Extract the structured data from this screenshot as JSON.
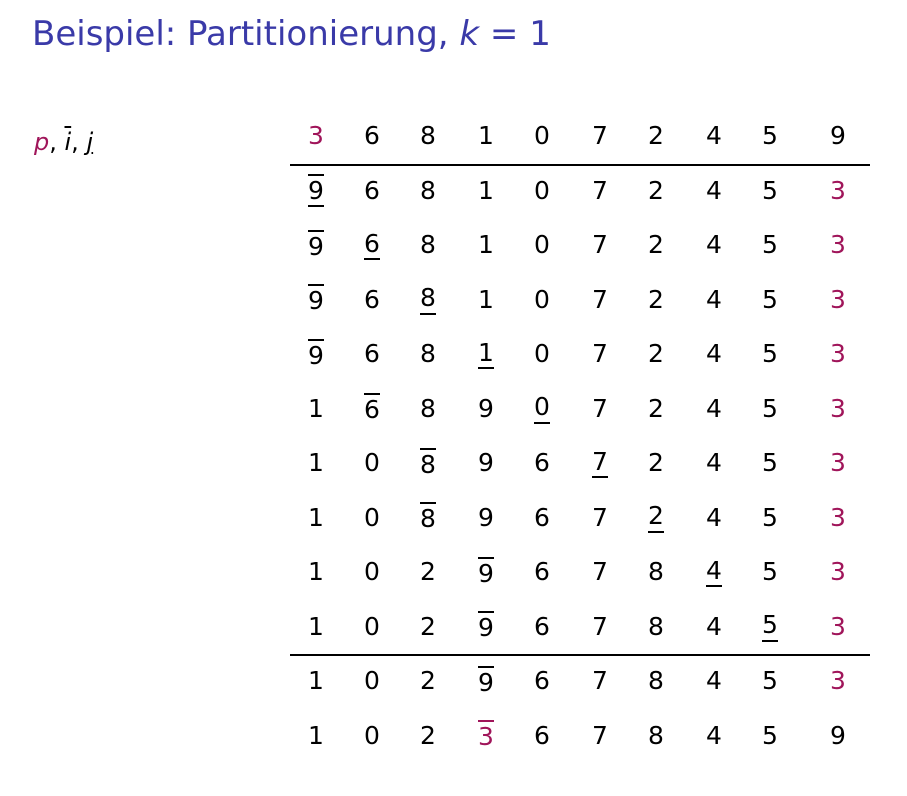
{
  "title": {
    "prefix": "Beispiel: Partitionierung, ",
    "var": "k",
    "suffix": " = 1"
  },
  "legend": {
    "pivot": "p",
    "sep1": ", ",
    "i": "i",
    "sep2": ", ",
    "j": "j"
  },
  "colors": {
    "title": "#3a3aa8",
    "pivot": "#a0155a",
    "text": "#000000"
  },
  "rows": [
    {
      "cells": [
        {
          "v": "3",
          "pivot": true
        },
        {
          "v": "6"
        },
        {
          "v": "8"
        },
        {
          "v": "1"
        },
        {
          "v": "0"
        },
        {
          "v": "7"
        },
        {
          "v": "2"
        },
        {
          "v": "4"
        },
        {
          "v": "5"
        },
        {
          "v": "9"
        }
      ]
    },
    {
      "cells": [
        {
          "v": "9",
          "over": true,
          "under": true
        },
        {
          "v": "6"
        },
        {
          "v": "8"
        },
        {
          "v": "1"
        },
        {
          "v": "0"
        },
        {
          "v": "7"
        },
        {
          "v": "2"
        },
        {
          "v": "4"
        },
        {
          "v": "5"
        },
        {
          "v": "3",
          "pivot": true
        }
      ]
    },
    {
      "cells": [
        {
          "v": "9",
          "over": true
        },
        {
          "v": "6",
          "under": true
        },
        {
          "v": "8"
        },
        {
          "v": "1"
        },
        {
          "v": "0"
        },
        {
          "v": "7"
        },
        {
          "v": "2"
        },
        {
          "v": "4"
        },
        {
          "v": "5"
        },
        {
          "v": "3",
          "pivot": true
        }
      ]
    },
    {
      "cells": [
        {
          "v": "9",
          "over": true
        },
        {
          "v": "6"
        },
        {
          "v": "8",
          "under": true
        },
        {
          "v": "1"
        },
        {
          "v": "0"
        },
        {
          "v": "7"
        },
        {
          "v": "2"
        },
        {
          "v": "4"
        },
        {
          "v": "5"
        },
        {
          "v": "3",
          "pivot": true
        }
      ]
    },
    {
      "cells": [
        {
          "v": "9",
          "over": true
        },
        {
          "v": "6"
        },
        {
          "v": "8"
        },
        {
          "v": "1",
          "under": true
        },
        {
          "v": "0"
        },
        {
          "v": "7"
        },
        {
          "v": "2"
        },
        {
          "v": "4"
        },
        {
          "v": "5"
        },
        {
          "v": "3",
          "pivot": true
        }
      ]
    },
    {
      "cells": [
        {
          "v": "1"
        },
        {
          "v": "6",
          "over": true
        },
        {
          "v": "8"
        },
        {
          "v": "9"
        },
        {
          "v": "0",
          "under": true
        },
        {
          "v": "7"
        },
        {
          "v": "2"
        },
        {
          "v": "4"
        },
        {
          "v": "5"
        },
        {
          "v": "3",
          "pivot": true
        }
      ]
    },
    {
      "cells": [
        {
          "v": "1"
        },
        {
          "v": "0"
        },
        {
          "v": "8",
          "over": true
        },
        {
          "v": "9"
        },
        {
          "v": "6"
        },
        {
          "v": "7",
          "under": true
        },
        {
          "v": "2"
        },
        {
          "v": "4"
        },
        {
          "v": "5"
        },
        {
          "v": "3",
          "pivot": true
        }
      ]
    },
    {
      "cells": [
        {
          "v": "1"
        },
        {
          "v": "0"
        },
        {
          "v": "8",
          "over": true
        },
        {
          "v": "9"
        },
        {
          "v": "6"
        },
        {
          "v": "7"
        },
        {
          "v": "2",
          "under": true
        },
        {
          "v": "4"
        },
        {
          "v": "5"
        },
        {
          "v": "3",
          "pivot": true
        }
      ]
    },
    {
      "cells": [
        {
          "v": "1"
        },
        {
          "v": "0"
        },
        {
          "v": "2"
        },
        {
          "v": "9",
          "over": true
        },
        {
          "v": "6"
        },
        {
          "v": "7"
        },
        {
          "v": "8"
        },
        {
          "v": "4",
          "under": true
        },
        {
          "v": "5"
        },
        {
          "v": "3",
          "pivot": true
        }
      ]
    },
    {
      "cells": [
        {
          "v": "1"
        },
        {
          "v": "0"
        },
        {
          "v": "2"
        },
        {
          "v": "9",
          "over": true
        },
        {
          "v": "6"
        },
        {
          "v": "7"
        },
        {
          "v": "8"
        },
        {
          "v": "4"
        },
        {
          "v": "5",
          "under": true
        },
        {
          "v": "3",
          "pivot": true
        }
      ]
    },
    {
      "cells": [
        {
          "v": "1"
        },
        {
          "v": "0"
        },
        {
          "v": "2"
        },
        {
          "v": "9",
          "over": true
        },
        {
          "v": "6"
        },
        {
          "v": "7"
        },
        {
          "v": "8"
        },
        {
          "v": "4"
        },
        {
          "v": "5"
        },
        {
          "v": "3",
          "pivot": true
        }
      ]
    },
    {
      "cells": [
        {
          "v": "1"
        },
        {
          "v": "0"
        },
        {
          "v": "2"
        },
        {
          "v": "3",
          "over": true,
          "pivot": true
        },
        {
          "v": "6"
        },
        {
          "v": "7"
        },
        {
          "v": "8"
        },
        {
          "v": "4"
        },
        {
          "v": "5"
        },
        {
          "v": "9"
        }
      ]
    }
  ],
  "rules_after_rows": [
    0,
    9
  ]
}
